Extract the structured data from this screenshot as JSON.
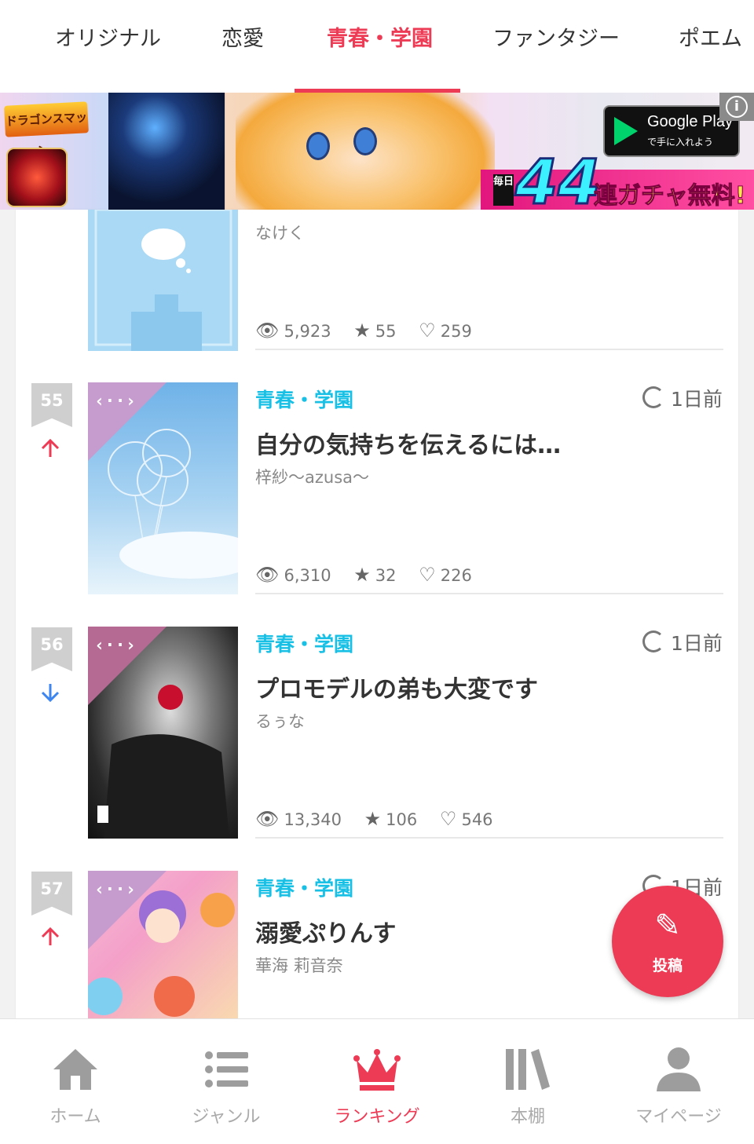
{
  "tabs": [
    {
      "label": "オリジナル",
      "active": false
    },
    {
      "label": "恋愛",
      "active": false
    },
    {
      "label": "青春・学園",
      "active": true
    },
    {
      "label": "ファンタジー",
      "active": false
    },
    {
      "label": "ポエム",
      "active": false
    }
  ],
  "ad": {
    "game_logo": "ドラゴンスマッシュ",
    "store_title": "Google Play",
    "store_sub": "で手に入れよう",
    "promo_daily": "毎日",
    "promo_number": "44",
    "promo_text": "連ガチャ無料!",
    "info": "i"
  },
  "partial_item": {
    "author": "なけく",
    "views": "5,923",
    "stars": "55",
    "likes": "259"
  },
  "items": [
    {
      "rank": "55",
      "trend": "up",
      "genre": "青春・学園",
      "time": "1日前",
      "title": "自分の気持ちを伝えるには…",
      "author": "梓紗～azusa～",
      "views": "6,310",
      "stars": "32",
      "likes": "226"
    },
    {
      "rank": "56",
      "trend": "down",
      "genre": "青春・学園",
      "time": "1日前",
      "title": "プロモデルの弟も大変です",
      "author": "るぅな",
      "views": "13,340",
      "stars": "106",
      "likes": "546"
    },
    {
      "rank": "57",
      "trend": "up",
      "genre": "青春・学園",
      "time": "1日前",
      "title": "溺愛ぷりんす",
      "author": "華海 莉音奈"
    }
  ],
  "cover_icon": "‹··›",
  "fab": {
    "label": "投稿"
  },
  "bottom_nav": [
    {
      "label": "ホーム",
      "icon": "home-icon"
    },
    {
      "label": "ジャンル",
      "icon": "list-icon"
    },
    {
      "label": "ランキング",
      "icon": "crown-icon",
      "active": true
    },
    {
      "label": "本棚",
      "icon": "bookshelf-icon"
    },
    {
      "label": "マイページ",
      "icon": "person-icon"
    }
  ],
  "colors": {
    "accent": "#ee3b55",
    "genre": "#18c0e6",
    "up": "#ee3b55",
    "down": "#3d86f0"
  }
}
